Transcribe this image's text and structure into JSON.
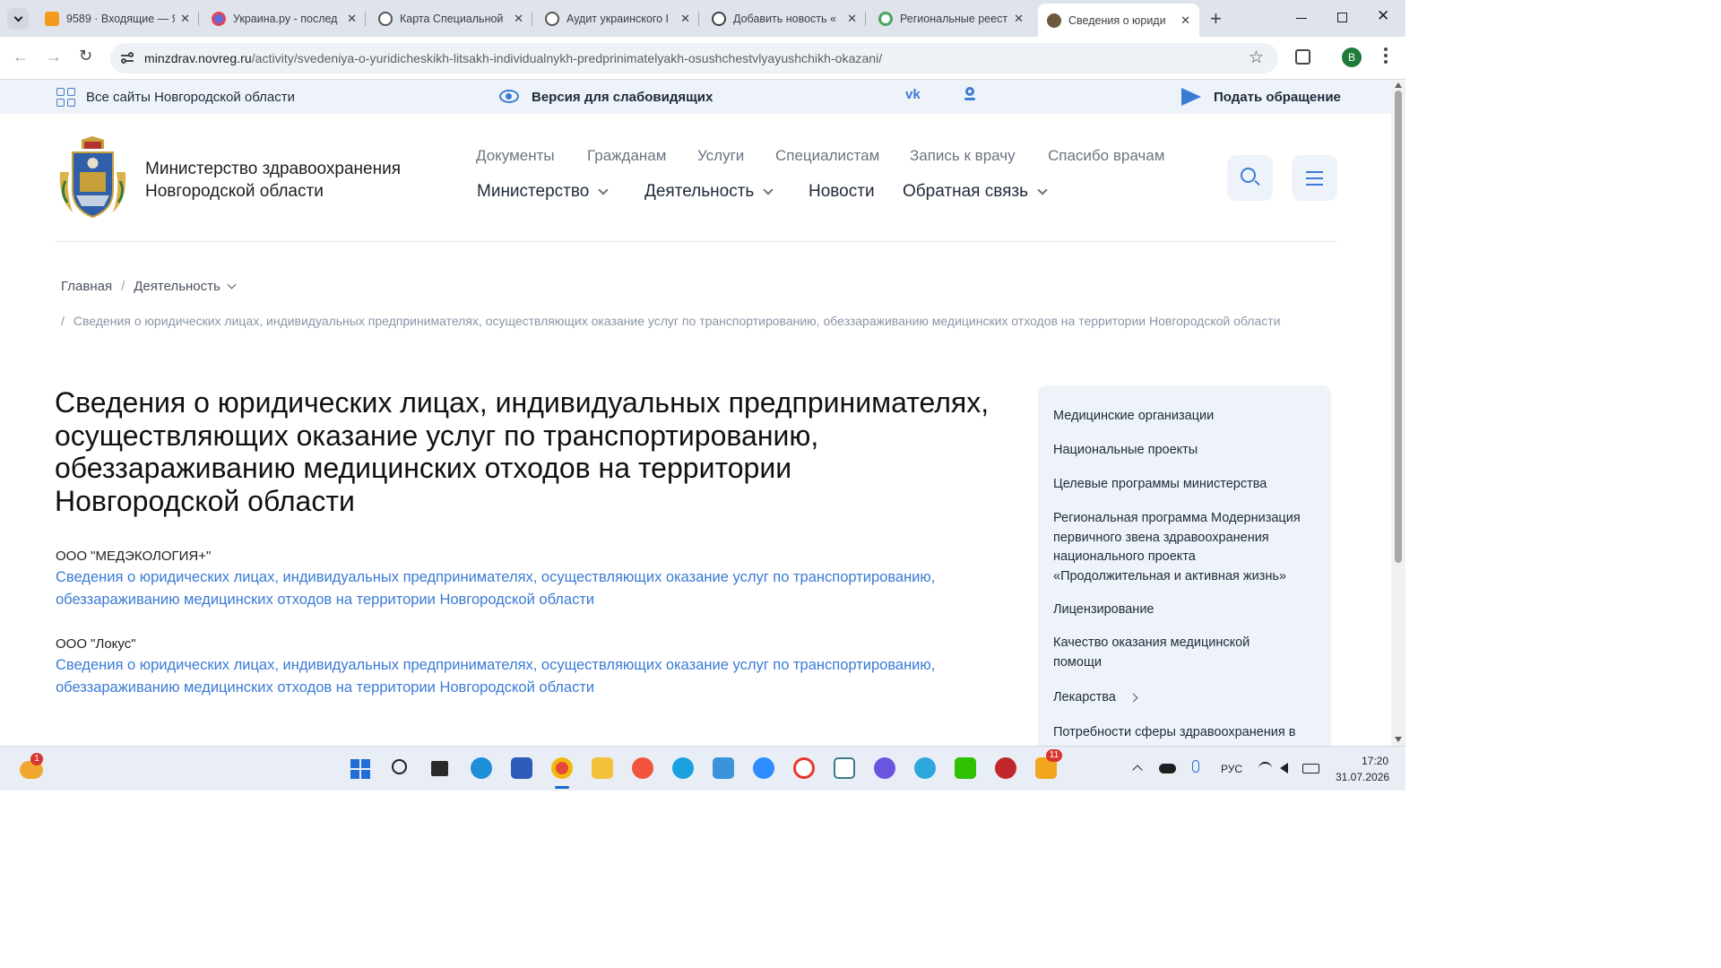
{
  "browser": {
    "tabs": [
      {
        "title": "9589 · Входящие — Я",
        "close": "✕"
      },
      {
        "title": "Украина.ру - послед",
        "close": "✕"
      },
      {
        "title": "Карта Специальной",
        "close": "✕"
      },
      {
        "title": "Аудит украинского I",
        "close": "✕"
      },
      {
        "title": "Добавить новость «",
        "close": "✕"
      },
      {
        "title": "Региональные реест",
        "close": "✕"
      },
      {
        "title": "Сведения о юриди",
        "close": "✕"
      }
    ],
    "new_tab": "+",
    "url_domain": "minzdrav.novreg.ru",
    "url_path": "/activity/svedeniya-o-yuridicheskikh-litsakh-individualnykh-predprinimatelyakh-osushchestvlyayushchikh-okazani/",
    "profile_initial": "В",
    "accent": "#1a73e8"
  },
  "topstrip": {
    "all_sites": "Все сайты Новгородской области",
    "low_vision": "Версия для слабовидящих",
    "vk": "vk",
    "ok": "ok",
    "appeal": "Подать обращение"
  },
  "header": {
    "org_line1": "Министерство здравоохранения",
    "org_line2": "Новгородской области",
    "nav_top": [
      "Документы",
      "Гражданам",
      "Услуги",
      "Специалистам",
      "Запись к врачу",
      "Спасибо врачам"
    ],
    "nav_main": [
      "Министерство",
      "Деятельность",
      "Новости",
      "Обратная связь"
    ]
  },
  "breadcrumb": {
    "home": "Главная",
    "sep": "/",
    "section": "Деятельность",
    "current": "Сведения о юридических лицах, индивидуальных предпринимателях, осуществляющих оказание услуг по транспортированию, обеззараживанию медицинских отходов на территории Новгородской области"
  },
  "main": {
    "title_lines": [
      "Сведения о юридических лицах, индивидуальных предпринимателях,",
      "осуществляющих оказание услуг по транспортированию,",
      "обеззараживанию медицинских отходов на территории",
      "Новгородской области"
    ],
    "orgs": [
      {
        "name": "ООО \"МЕДЭКОЛОГИЯ+\"",
        "link_line1": "Сведения о юридических лицах, индивидуальных предпринимателях, осуществляющих оказание услуг по транспортированию,",
        "link_line2": "обеззараживанию медицинских отходов на территории Новгородской области"
      },
      {
        "name": "ООО \"Локус\"",
        "link_line1": "Сведения о юридических лицах, индивидуальных предпринимателях, осуществляющих оказание услуг по транспортированию,",
        "link_line2": "обеззараживанию медицинских отходов на территории Новгородской области"
      }
    ]
  },
  "sidebar": {
    "items": [
      "Медицинские организации",
      "Национальные проекты",
      "Целевые программы министерства",
      "Региональная программа Модернизация первичного звена здравоохранения национального проекта «Продолжительная и активная жизнь»",
      "Лицензирование",
      "Качество оказания медицинской помощи",
      "Лекарства",
      "Потребности сферы здравоохранения в"
    ]
  },
  "taskbar": {
    "weather_badge": "1",
    "mail_badge": "11",
    "lang": "РУС",
    "time": "17:20",
    "date": "31.07.2026"
  }
}
